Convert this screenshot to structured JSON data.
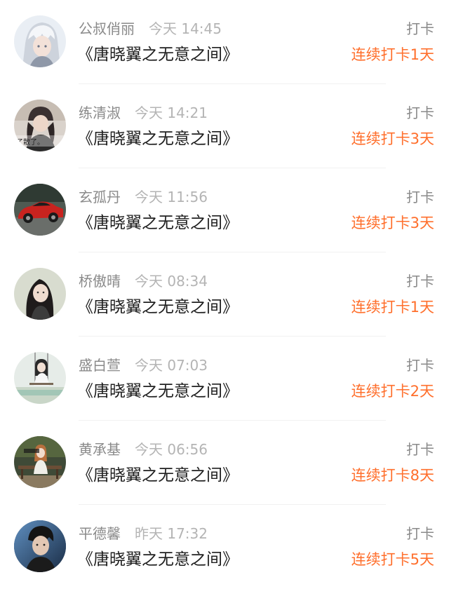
{
  "accent_color": "#ff6f2c",
  "entries": [
    {
      "username": "公叔俏丽",
      "time": "今天 14:45",
      "book": "《唐晓翼之无意之间》",
      "action": "打卡",
      "streak": "连续打卡1天",
      "avatar_icon": "user-avatar-anime-silver-hair"
    },
    {
      "username": "练清淑",
      "time": "今天 14:21",
      "book": "《唐晓翼之无意之间》",
      "action": "打卡",
      "streak": "连续打卡3天",
      "avatar_icon": "user-avatar-girl-with-hat",
      "avatar_text": "了散了。"
    },
    {
      "username": "玄孤丹",
      "time": "今天 11:56",
      "book": "《唐晓翼之无意之间》",
      "action": "打卡",
      "streak": "连续打卡3天",
      "avatar_icon": "user-avatar-red-sports-car"
    },
    {
      "username": "桥傲晴",
      "time": "今天 08:34",
      "book": "《唐晓翼之无意之间》",
      "action": "打卡",
      "streak": "连续打卡1天",
      "avatar_icon": "user-avatar-girl-portrait"
    },
    {
      "username": "盛白萱",
      "time": "今天 07:03",
      "book": "《唐晓翼之无意之间》",
      "action": "打卡",
      "streak": "连续打卡2天",
      "avatar_icon": "user-avatar-girl-on-swing"
    },
    {
      "username": "黄承基",
      "time": "今天 06:56",
      "book": "《唐晓翼之无意之间》",
      "action": "打卡",
      "streak": "连续打卡8天",
      "avatar_icon": "user-avatar-girl-on-bench"
    },
    {
      "username": "平德馨",
      "time": "昨天 17:32",
      "book": "《唐晓翼之无意之间》",
      "action": "打卡",
      "streak": "连续打卡5天",
      "avatar_icon": "user-avatar-man-portrait"
    }
  ]
}
